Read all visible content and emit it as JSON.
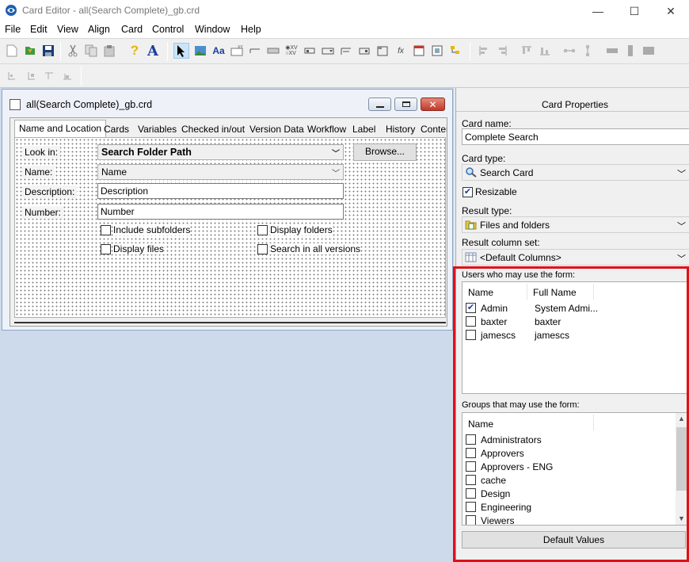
{
  "window": {
    "title": "Card Editor - all(Search Complete)_gb.crd",
    "minimize": "—",
    "maximize": "☐",
    "close": "✕"
  },
  "menu": [
    "File",
    "Edit",
    "View",
    "Align",
    "Card",
    "Control",
    "Window",
    "Help"
  ],
  "child_window": {
    "title": "all(Search Complete)_gb.crd",
    "tabs": [
      "Name and Location",
      "Cards",
      "Variables",
      "Checked in/out",
      "Version Data",
      "Workflow",
      "Label",
      "History",
      "Conten"
    ],
    "active_tab": "Name and Location",
    "form": {
      "look_in_label": "Look in:",
      "look_in_value": "Search Folder Path",
      "browse_label": "Browse...",
      "name_label": "Name:",
      "name_value": "Name",
      "description_label": "Description:",
      "description_value": "Description",
      "number_label": "Number:",
      "number_value": "Number",
      "include_subfolders": "Include subfolders",
      "display_folders": "Display folders",
      "display_files": "Display files",
      "search_all_versions": "Search in all versions"
    }
  },
  "properties": {
    "title": "Card Properties",
    "card_name_label": "Card name:",
    "card_name_value": "Complete Search",
    "card_type_label": "Card type:",
    "card_type_value": "Search Card",
    "resizable_label": "Resizable",
    "resizable_checked": true,
    "result_type_label": "Result type:",
    "result_type_value": "Files and folders",
    "result_column_set_label": "Result column set:",
    "result_column_set_value": "<Default Columns>",
    "users_label": "Users who may use the form:",
    "users_columns": [
      "Name",
      "Full Name"
    ],
    "users": [
      {
        "name": "Admin",
        "full_name": "System Admi...",
        "checked": true
      },
      {
        "name": "baxter",
        "full_name": "baxter",
        "checked": false
      },
      {
        "name": "jamescs",
        "full_name": "jamescs",
        "checked": false
      }
    ],
    "groups_label": "Groups that may use the form:",
    "groups_column": "Name",
    "groups": [
      "Administrators",
      "Approvers",
      "Approvers - ENG",
      "cache",
      "Design",
      "Engineering",
      "Viewers"
    ],
    "default_values_button": "Default Values"
  },
  "colors": {
    "highlight": "#e0101a",
    "workspace": "#cddaeb",
    "checkmark": "#1a3e9c"
  }
}
